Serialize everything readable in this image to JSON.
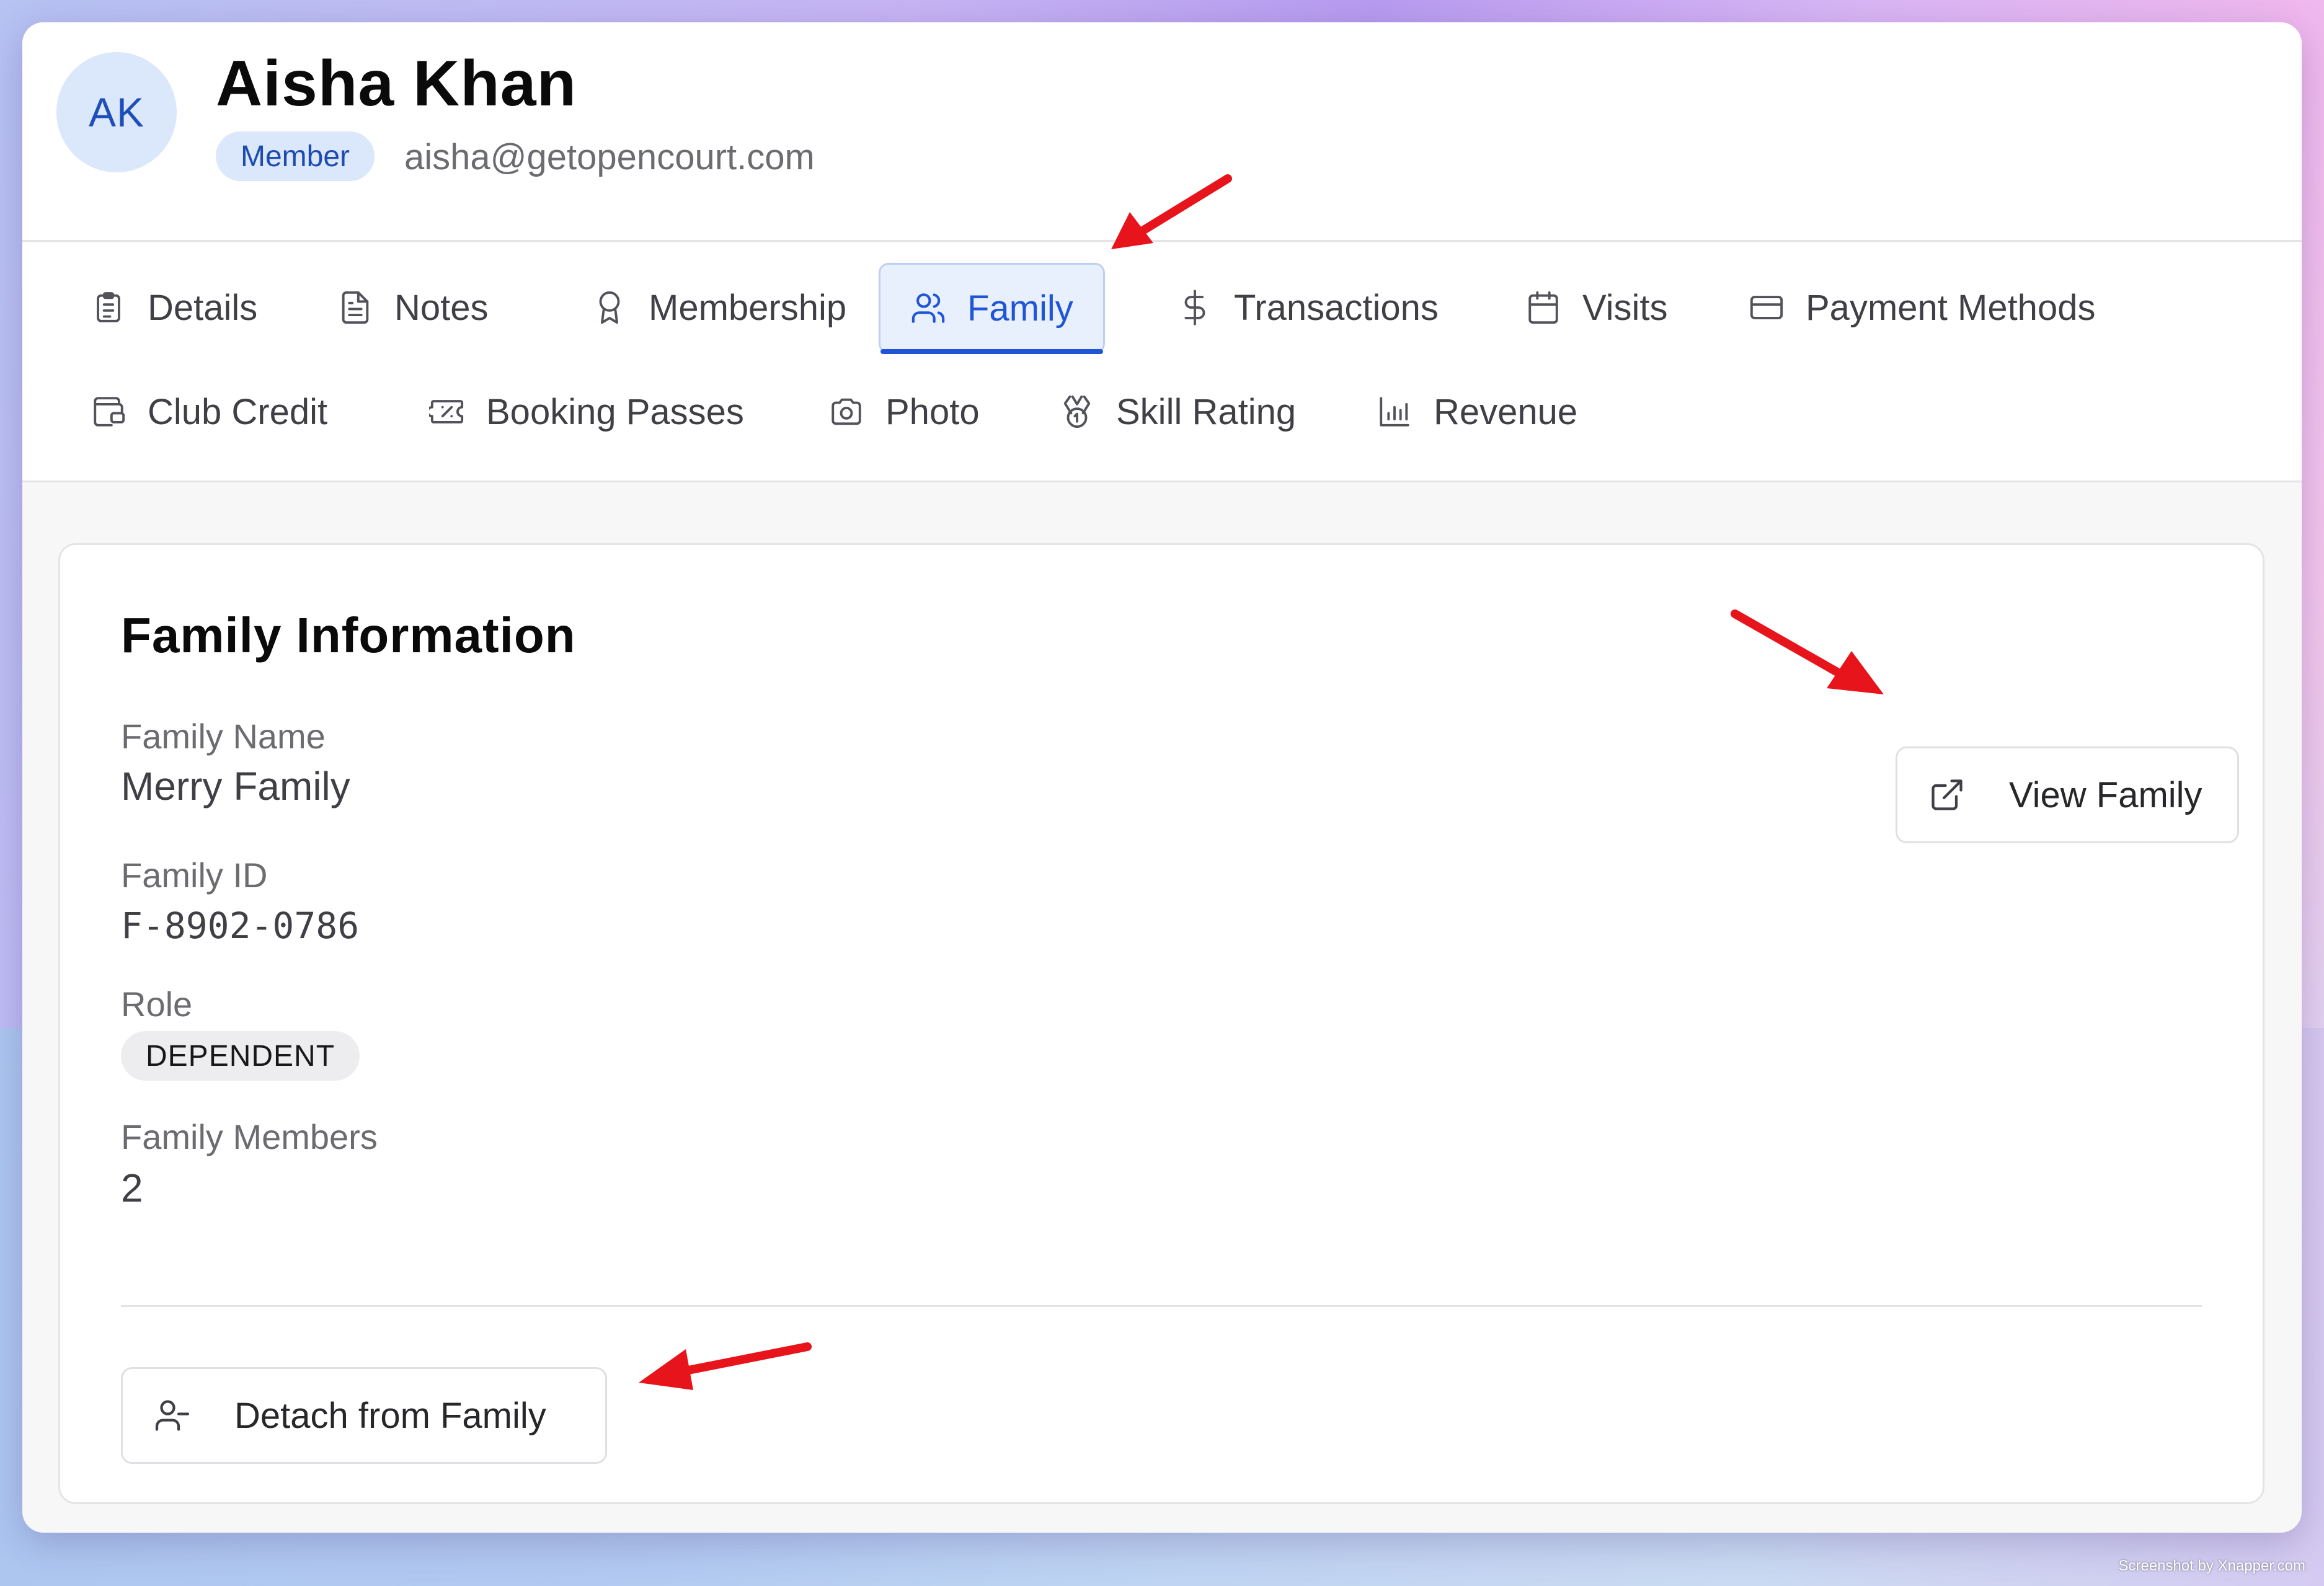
{
  "profile": {
    "initials": "AK",
    "name": "Aisha Khan",
    "role_badge": "Member",
    "email": "aisha@getopencourt.com"
  },
  "tabs": [
    {
      "label": "Details",
      "icon": "clipboard-icon"
    },
    {
      "label": "Notes",
      "icon": "document-icon"
    },
    {
      "label": "Membership",
      "icon": "award-ribbon-icon"
    },
    {
      "label": "Family",
      "icon": "users-icon",
      "active": true
    },
    {
      "label": "Transactions",
      "icon": "dollar-icon"
    },
    {
      "label": "Visits",
      "icon": "calendar-icon"
    },
    {
      "label": "Payment Methods",
      "icon": "credit-card-icon"
    },
    {
      "label": "Club Credit",
      "icon": "wallet-icon"
    },
    {
      "label": "Booking Passes",
      "icon": "ticket-icon"
    },
    {
      "label": "Photo",
      "icon": "camera-icon"
    },
    {
      "label": "Skill Rating",
      "icon": "medal-icon"
    },
    {
      "label": "Revenue",
      "icon": "bar-chart-icon"
    }
  ],
  "family": {
    "title": "Family Information",
    "name_label": "Family Name",
    "name_value": "Merry Family",
    "id_label": "Family ID",
    "id_value": "F-8902-0786",
    "role_label": "Role",
    "role_value": "DEPENDENT",
    "members_label": "Family Members",
    "members_value": "2",
    "view_button": "View Family",
    "detach_button": "Detach from Family"
  },
  "colors": {
    "accent": "#1f55d6",
    "annotation_arrow": "#e8141b"
  },
  "watermark": "Screenshot by Xnapper.com"
}
